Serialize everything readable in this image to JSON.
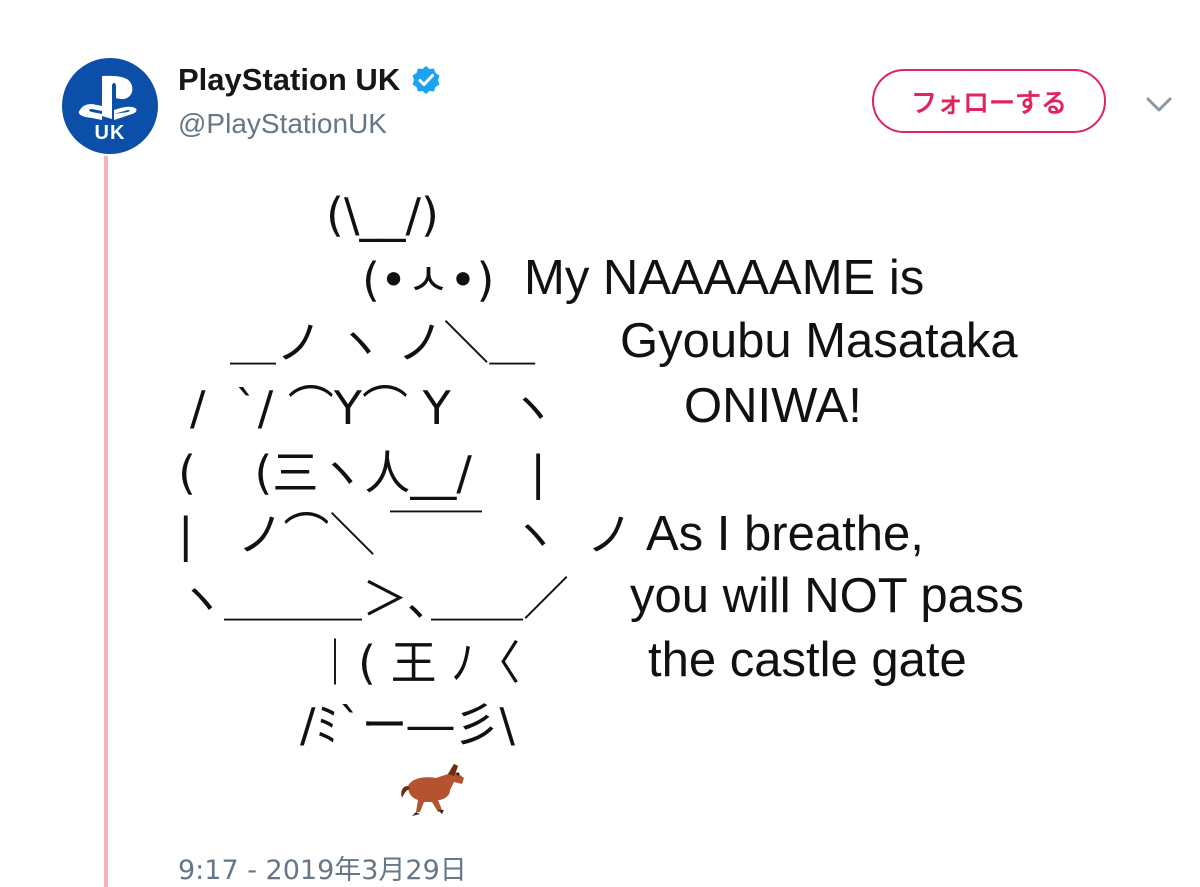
{
  "account": {
    "display_name": "PlayStation UK",
    "handle": "@PlayStationUK",
    "avatar_label": "UK",
    "verified": true
  },
  "actions": {
    "follow_label": "フォローする"
  },
  "tweet": {
    "ascii_art": [
      "(\\__/)",
      "(•ㅅ•)",
      "＿ノ ヽ ノ＼＿",
      "/  `/ ⌒Y⌒ Y    ヽ",
      "(    (三ヽ人__/    |",
      "|   ノ⌒＼ ￣￣  ヽ  ノ",
      "ヽ＿＿＿＞､＿＿／",
      "｜( 王 ﾉ〈",
      "/ﾐ`ー―彡\\"
    ],
    "caption_lines": [
      "My NAAAAAME is",
      "Gyoubu Masataka",
      "ONIWA!",
      "As I breathe,",
      "you will NOT pass",
      "the castle gate"
    ],
    "emoji": "horse-racing",
    "timestamp": "9:17 - 2019年3月29日"
  },
  "colors": {
    "follow_accent": "#e0245e",
    "verified_blue": "#1da1f2",
    "avatar_blue": "#0b4fa8",
    "thread_line": "#f5b4b8",
    "muted_text": "#657786"
  }
}
